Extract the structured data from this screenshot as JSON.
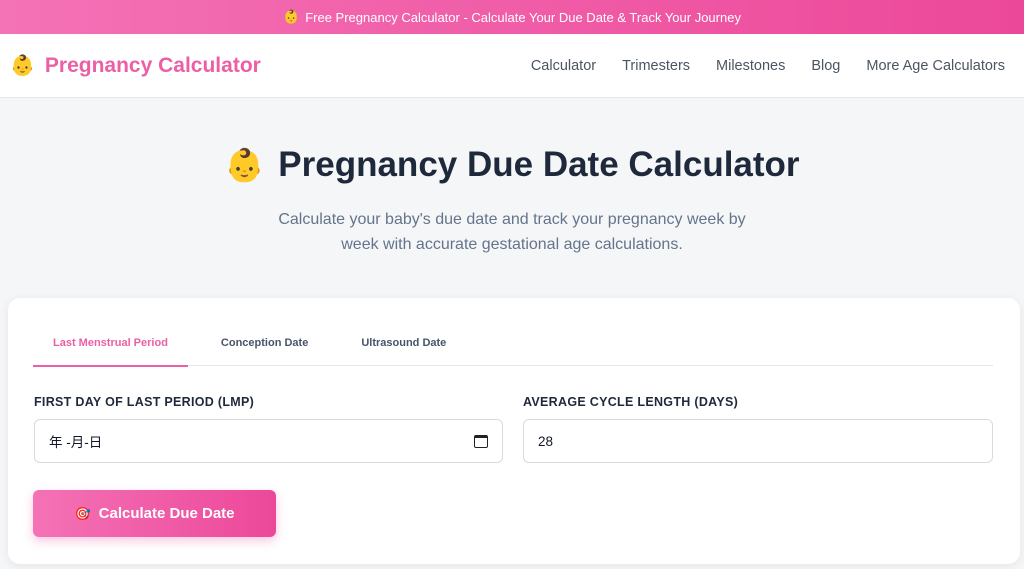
{
  "banner": {
    "icon": "👶",
    "text": "Free Pregnancy Calculator - Calculate Your Due Date & Track Your Journey"
  },
  "navbar": {
    "brand_icon": "👶",
    "brand_text": "Pregnancy Calculator",
    "links": [
      "Calculator",
      "Trimesters",
      "Milestones",
      "Blog",
      "More Age Calculators"
    ]
  },
  "hero": {
    "icon": "👶",
    "title": "Pregnancy Due Date Calculator",
    "subtitle": "Calculate your baby's due date and track your pregnancy week by week with accurate gestational age calculations."
  },
  "calculator": {
    "tabs": [
      "Last Menstrual Period",
      "Conception Date",
      "Ultrasound Date"
    ],
    "active_tab": "Last Menstrual Period",
    "lmp_label": "FIRST DAY OF LAST PERIOD (LMP)",
    "lmp_value": "年 -月-日",
    "cycle_label": "AVERAGE CYCLE LENGTH (DAYS)",
    "cycle_value": "28",
    "button_icon": "🎯",
    "button_label": "Calculate Due Date"
  },
  "colors": {
    "brand_pink": "#ec5fa4",
    "gradient_start": "#f472b6",
    "gradient_end": "#ec4899"
  }
}
